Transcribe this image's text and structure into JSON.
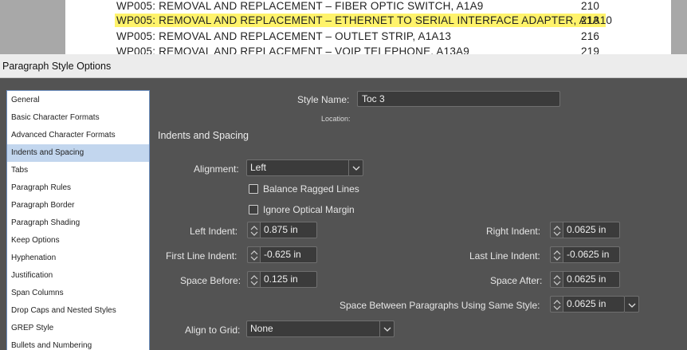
{
  "document": {
    "toc_lines": [
      {
        "text": "WP005:  REMOVAL AND REPLACEMENT – FIBER OPTIC SWITCH, A1A9",
        "page": "210",
        "highlighted": false
      },
      {
        "text": "WP005:  REMOVAL AND REPLACEMENT – ETHERNET TO SERIAL INTERFACE ADAPTER, A1A10",
        "page": "213",
        "highlighted": true
      },
      {
        "text": "WP005:  REMOVAL AND REPLACEMENT – OUTLET STRIP, A1A13",
        "page": "216",
        "highlighted": false
      },
      {
        "text": "WP005:  REMOVAL AND REPLACEMENT – VOIP TELEPHONE, A13A9",
        "page": "219",
        "highlighted": false
      }
    ],
    "highlight_color": "#fff36b"
  },
  "dialog": {
    "title": "Paragraph Style Options",
    "sidebar": {
      "items": [
        "General",
        "Basic Character Formats",
        "Advanced Character Formats",
        "Indents and Spacing",
        "Tabs",
        "Paragraph Rules",
        "Paragraph Border",
        "Paragraph Shading",
        "Keep Options",
        "Hyphenation",
        "Justification",
        "Span Columns",
        "Drop Caps and Nested Styles",
        "GREP Style",
        "Bullets and Numbering"
      ],
      "selected": "Indents and Spacing",
      "selected_color": "#c2d6ee"
    },
    "style_name": {
      "label": "Style Name:",
      "value": "Toc 3"
    },
    "location_label": "Location:",
    "section_title": "Indents and Spacing",
    "alignment": {
      "label": "Alignment:",
      "value": "Left"
    },
    "balance_ragged": {
      "label": "Balance Ragged Lines",
      "checked": false
    },
    "ignore_optical": {
      "label": "Ignore Optical Margin",
      "checked": false
    },
    "left_indent": {
      "label": "Left Indent:",
      "value": "0.875 in"
    },
    "right_indent": {
      "label": "Right Indent:",
      "value": "0.0625 in"
    },
    "first_line_indent": {
      "label": "First Line Indent:",
      "value": "-0.625 in"
    },
    "last_line_indent": {
      "label": "Last Line Indent:",
      "value": "-0.0625 in"
    },
    "space_before": {
      "label": "Space Before:",
      "value": "0.125 in"
    },
    "space_after": {
      "label": "Space After:",
      "value": "0.0625 in"
    },
    "space_between": {
      "label": "Space Between Paragraphs Using Same Style:",
      "value": "0.0625 in"
    },
    "align_to_grid": {
      "label": "Align to Grid:",
      "value": "None"
    }
  }
}
